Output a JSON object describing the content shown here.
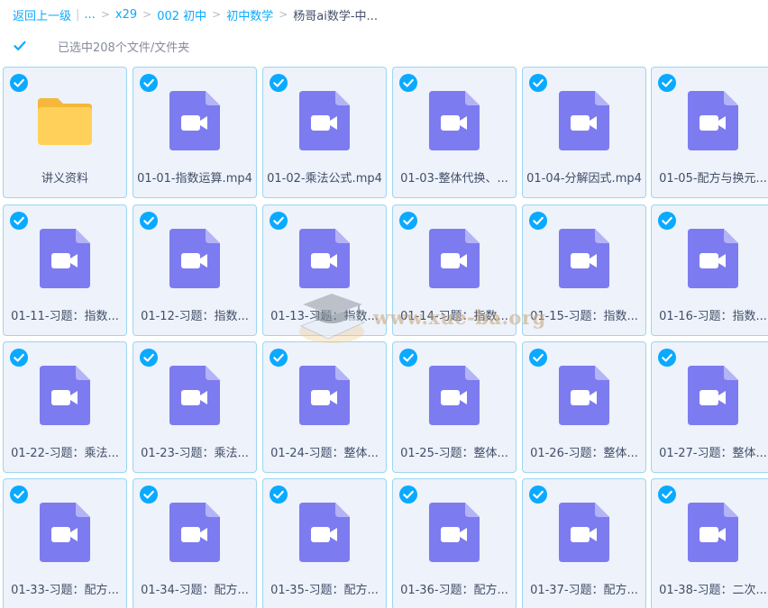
{
  "breadcrumb": {
    "back": "返回上一级",
    "ellipsis": "...",
    "items": [
      "x29",
      "002 初中",
      "初中数学"
    ],
    "current": "杨哥ai数学-中..."
  },
  "selection": {
    "text": "已选中208个文件/文件夹"
  },
  "icons": {
    "check": "check-circle-icon",
    "folder": "folder-icon",
    "video": "video-file-icon"
  },
  "colors": {
    "accent": "#09aaff",
    "card_bg": "#edf2fb",
    "card_border": "#9cd6f1",
    "video": "#7d7bf0",
    "folder": "#ffd15a"
  },
  "files": [
    {
      "name": "讲义资料",
      "type": "folder"
    },
    {
      "name": "01-01-指数运算.mp4",
      "type": "video"
    },
    {
      "name": "01-02-乘法公式.mp4",
      "type": "video"
    },
    {
      "name": "01-03-整体代换、...",
      "type": "video"
    },
    {
      "name": "01-04-分解因式.mp4",
      "type": "video"
    },
    {
      "name": "01-05-配方与换元...",
      "type": "video"
    },
    {
      "name": "01-11-习题：指数...",
      "type": "video"
    },
    {
      "name": "01-12-习题：指数...",
      "type": "video"
    },
    {
      "name": "01-13-习题：指数...",
      "type": "video"
    },
    {
      "name": "01-14-习题：指数...",
      "type": "video"
    },
    {
      "name": "01-15-习题：指数...",
      "type": "video"
    },
    {
      "name": "01-16-习题：指数...",
      "type": "video"
    },
    {
      "name": "01-22-习题：乘法...",
      "type": "video"
    },
    {
      "name": "01-23-习题：乘法...",
      "type": "video"
    },
    {
      "name": "01-24-习题：整体...",
      "type": "video"
    },
    {
      "name": "01-25-习题：整体...",
      "type": "video"
    },
    {
      "name": "01-26-习题：整体...",
      "type": "video"
    },
    {
      "name": "01-27-习题：整体...",
      "type": "video"
    },
    {
      "name": "01-33-习题：配方...",
      "type": "video"
    },
    {
      "name": "01-34-习题：配方...",
      "type": "video"
    },
    {
      "name": "01-35-习题：配方...",
      "type": "video"
    },
    {
      "name": "01-36-习题：配方...",
      "type": "video"
    },
    {
      "name": "01-37-习题：配方...",
      "type": "video"
    },
    {
      "name": "01-38-习题：二次...",
      "type": "video"
    }
  ],
  "watermark": {
    "text": "www.xue-ba.org"
  }
}
